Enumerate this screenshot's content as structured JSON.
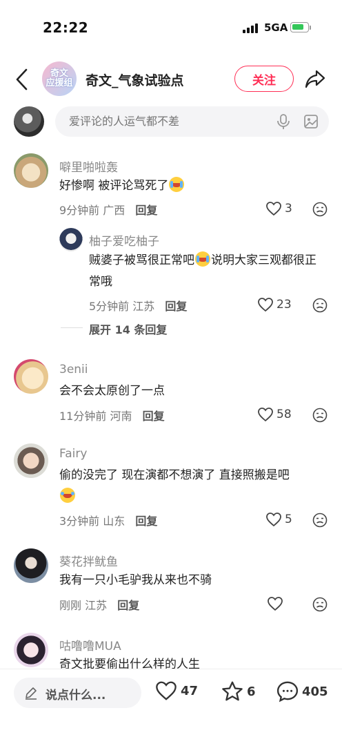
{
  "status": {
    "time": "22:22",
    "network": "5GA"
  },
  "header": {
    "title": "奇文_气象试验点",
    "follow": "关注",
    "avatar_text": "奇文\n应援组"
  },
  "comment_input": {
    "placeholder": "爱评论的人运气都不差"
  },
  "comments": [
    {
      "name": "噼里啪啦轰",
      "text": "好惨啊 被评论骂死了",
      "time": "9分钟前",
      "location": "广西",
      "reply": "回复",
      "likes": "3",
      "replies": [
        {
          "name": "柚子爱吃柚子",
          "text_part1": "贼婆子被骂很正常吧",
          "text_part2": "说明大家三观都很正常哦",
          "time": "5分钟前",
          "location": "江苏",
          "reply": "回复",
          "likes": "23"
        }
      ],
      "expand": "展开 14 条回复"
    },
    {
      "name": "3enii",
      "text": "会不会太原创了一点",
      "time": "11分钟前",
      "location": "河南",
      "reply": "回复",
      "likes": "58"
    },
    {
      "name": "Fairy",
      "text": "偷的没完了 现在演都不想演了 直接照搬是吧",
      "time": "3分钟前",
      "location": "山东",
      "reply": "回复",
      "likes": "5"
    },
    {
      "name": "葵花拌鱿鱼",
      "text": "我有一只小毛驴我从来也不骑",
      "time": "刚刚",
      "location": "江苏",
      "reply": "回复",
      "likes": ""
    },
    {
      "name": "咕噜噜MUA",
      "text": "奇文批要偷出什么样的人生"
    }
  ],
  "bottom": {
    "input_label": "说点什么...",
    "likes": "47",
    "favorites": "6",
    "comments": "405"
  },
  "colors": {
    "accent": "#ff2e55",
    "muted": "#888888",
    "battery": "#34c759"
  },
  "icons": [
    "back-icon",
    "share-icon",
    "mic-icon",
    "image-icon",
    "heart-icon",
    "dislike-icon",
    "pen-icon",
    "star-icon",
    "comment-icon"
  ]
}
